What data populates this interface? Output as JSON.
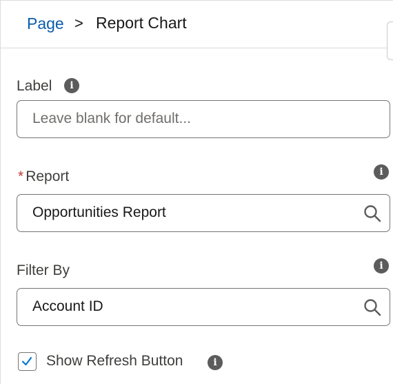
{
  "breadcrumb": {
    "parent": "Page",
    "separator": ">",
    "current": "Report Chart"
  },
  "fields": {
    "label": {
      "label": "Label",
      "placeholder": "Leave blank for default...",
      "value": ""
    },
    "report": {
      "required_marker": "*",
      "label": "Report",
      "value": "Opportunities Report"
    },
    "filter_by": {
      "label": "Filter By",
      "value": "Account ID"
    }
  },
  "show_refresh": {
    "label": "Show Refresh Button",
    "checked": true
  },
  "icons": {
    "info": "info-icon",
    "search": "search-icon",
    "check": "checkmark-icon"
  },
  "colors": {
    "link": "#0b5cab",
    "required": "#c23934",
    "checkmark": "#0176d3"
  }
}
